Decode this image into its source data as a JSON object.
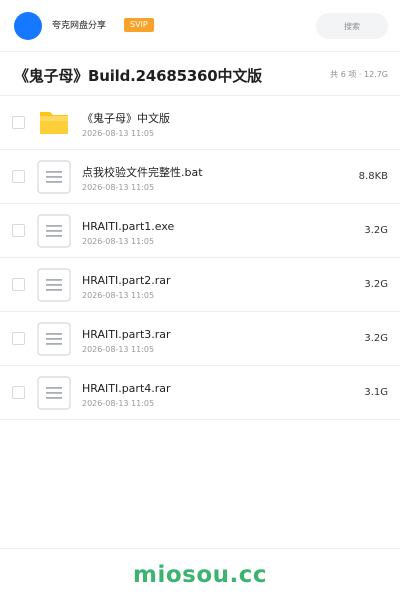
{
  "header": {
    "account_name": "夸克网盘分享",
    "badge": "SVIP",
    "search_label": "搜索"
  },
  "share": {
    "title": "《鬼子母》Build.24685360中文版",
    "summary": "共 6 项 · 12.7G"
  },
  "files": [
    {
      "type": "folder",
      "icon": "folder-icon",
      "name": "《鬼子母》中文版",
      "date": "2026-08-13 11:05",
      "size": ""
    },
    {
      "type": "file",
      "icon": "document-icon",
      "name": "点我校验文件完整性.bat",
      "date": "2026-08-13 11:05",
      "size": "8.8KB"
    },
    {
      "type": "file",
      "icon": "document-icon",
      "name": "HRAITI.part1.exe",
      "date": "2026-08-13 11:05",
      "size": "3.2G"
    },
    {
      "type": "file",
      "icon": "document-icon",
      "name": "HRAITI.part2.rar",
      "date": "2026-08-13 11:05",
      "size": "3.2G"
    },
    {
      "type": "file",
      "icon": "document-icon",
      "name": "HRAITI.part3.rar",
      "date": "2026-08-13 11:05",
      "size": "3.2G"
    },
    {
      "type": "file",
      "icon": "document-icon",
      "name": "HRAITI.part4.rar",
      "date": "2026-08-13 11:05",
      "size": "3.1G"
    }
  ],
  "footer": {
    "watermark": "miosou.cc"
  },
  "colors": {
    "avatar": "#1677ff",
    "badge": "#f7a22b",
    "folder": "#ffc31a",
    "watermark": "#3cb371"
  }
}
